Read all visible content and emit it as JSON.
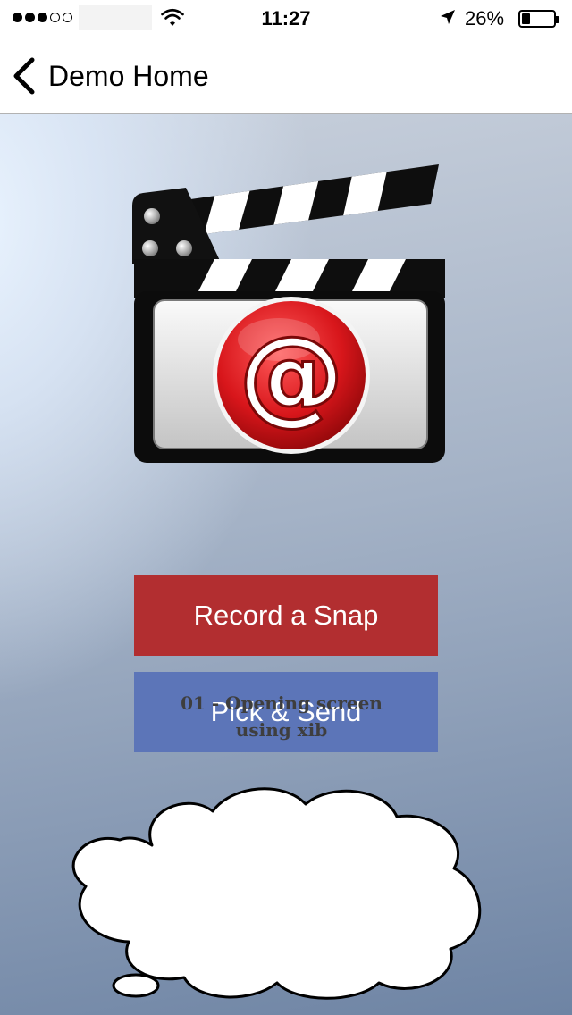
{
  "status_bar": {
    "signal_dots": [
      "filled",
      "filled",
      "filled",
      "empty",
      "empty"
    ],
    "wifi_icon": "wifi-icon",
    "time": "11:27",
    "location_icon": "location-arrow-icon",
    "battery_percent_text": "26%",
    "battery_level": 0.26
  },
  "nav": {
    "back_icon": "chevron-left-icon",
    "back_label": "Demo Home"
  },
  "hero": {
    "icon": "clapperboard-email-icon"
  },
  "buttons": {
    "record_label": "Record a Snap",
    "pick_label": "Pick & Send"
  },
  "colors": {
    "record_button": "#b22e30",
    "pick_button": "#5c75b8",
    "email_badge": "#d8161b"
  },
  "thought_bubble": {
    "line1": "01 - Opening screen",
    "line2": "using xib"
  }
}
